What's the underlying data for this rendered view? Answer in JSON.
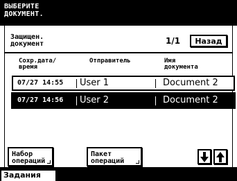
{
  "header": {
    "message": "ВЫБЕРИТЕ\nДОКУМЕНТ."
  },
  "panel": {
    "doc_type": "Защищен.\nдокумент",
    "page_indicator": "1/1",
    "back_label": "Назад"
  },
  "table": {
    "columns": [
      "Сохр.дата/\nвремя",
      "Отправитель",
      "Имя\nдокумента"
    ],
    "rows": [
      {
        "datetime": "07/27  14:55",
        "sender": "User 1",
        "document": "Document 2",
        "selected": false
      },
      {
        "datetime": "07/27  14:56",
        "sender": "User 2",
        "document": "Document 2",
        "selected": true
      }
    ]
  },
  "buttons": {
    "op_set": "Набор\nопераций",
    "op_batch": "Пакет\nопераций",
    "scroll_down_icon": "arrow-down-icon",
    "scroll_up_icon": "arrow-up-icon"
  },
  "footer": {
    "tab_label": "Задания"
  }
}
